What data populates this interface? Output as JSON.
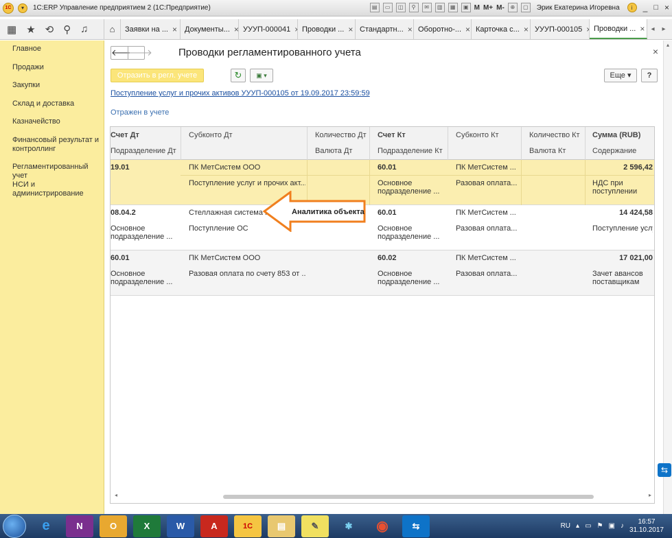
{
  "window": {
    "title": "1С:ERP Управление предприятием 2 (1С:Предприятие)",
    "user": "Эрик Екатерина Игоревна",
    "toolbar_text": [
      "M",
      "M+",
      "M-"
    ]
  },
  "tabs": [
    {
      "label": "Заявки на ...",
      "active": false
    },
    {
      "label": "Документы...",
      "active": false
    },
    {
      "label": "УУУП-000041",
      "active": false
    },
    {
      "label": "Проводки ...",
      "active": false
    },
    {
      "label": "Стандартн...",
      "active": false
    },
    {
      "label": "Оборотно-...",
      "active": false
    },
    {
      "label": "Карточка с...",
      "active": false
    },
    {
      "label": "УУУП-000105",
      "active": false
    },
    {
      "label": "Проводки ...",
      "active": true
    }
  ],
  "sidebar": {
    "items": [
      {
        "label": "Главное"
      },
      {
        "label": "Продажи"
      },
      {
        "label": "Закупки"
      },
      {
        "label": "Склад и доставка"
      },
      {
        "label": "Казначейство"
      },
      {
        "label": "Финансовый результат и контроллинг"
      },
      {
        "label": "Регламентированный учет"
      },
      {
        "label": "НСИ и администрирование"
      }
    ]
  },
  "form": {
    "title": "Проводки регламентированного учета",
    "post_button": "Отразить в регл. учете",
    "more_button": "Еще",
    "help_button": "?",
    "document_link": "Поступление услуг и прочих активов УУУП-000105 от 19.09.2017 23:59:59",
    "status": "Отражен в учете"
  },
  "table": {
    "headers_top": [
      "Счет Дт",
      "Субконто Дт",
      "Количество Дт",
      "Счет Кт",
      "Субконто Кт",
      "Количество Кт",
      "Сумма (RUB)"
    ],
    "headers_bottom": [
      "Подразделение Дт",
      "",
      "Валюта Дт",
      "Подразделение Кт",
      "",
      "Валюта Кт",
      "Содержание"
    ],
    "rows": [
      {
        "account_dt": "19.01",
        "subconto_dt_1": "ПК МетСистем ООО",
        "subconto_dt_2": "Поступление услуг и прочих акт...",
        "dept_dt": "",
        "account_kt": "60.01",
        "subconto_kt_1": "ПК МетСистем ...",
        "subconto_kt_2": "Разовая оплата...",
        "dept_kt": "Основное подразделение ...",
        "amount": "2 596,42",
        "content": "НДС при поступлении"
      },
      {
        "account_dt": "08.04.2",
        "subconto_dt_1": "Стеллажная система Г",
        "subconto_dt_2": "Поступление ОС",
        "dept_dt": "Основное подразделение ...",
        "account_kt": "60.01",
        "subconto_kt_1": "ПК МетСистем ...",
        "subconto_kt_2": "Разовая оплата...",
        "dept_kt": "Основное подразделение ...",
        "amount": "14 424,58",
        "content": "Поступление услуг"
      },
      {
        "account_dt": "60.01",
        "subconto_dt_1": "ПК МетСистем ООО",
        "subconto_dt_2": "Разовая оплата по счету 853 от ...",
        "dept_dt": "Основное подразделение ...",
        "account_kt": "60.02",
        "subconto_kt_1": "ПК МетСистем ...",
        "subconto_kt_2": "Разовая оплата...",
        "dept_kt": "Основное подразделение ...",
        "amount": "17 021,00",
        "content": "Зачет авансов поставщикам"
      }
    ]
  },
  "annotation": {
    "label": "Аналитика объекта",
    "color": "#f07f1e"
  },
  "taskbar": {
    "language": "RU",
    "time": "16:57",
    "date": "31.10.2017",
    "apps": [
      "IE",
      "OneNote",
      "Outlook",
      "Excel",
      "Word",
      "Acrobat",
      "1C",
      "Explorer",
      "Notes",
      "Tool",
      "Chrome",
      "TeamViewer"
    ]
  }
}
